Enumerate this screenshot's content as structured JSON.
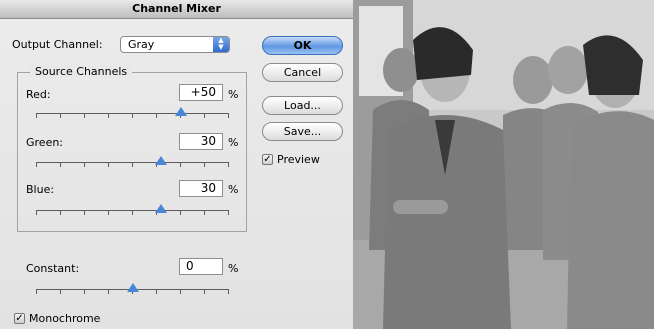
{
  "dialog": {
    "title": "Channel Mixer",
    "output_channel_label": "Output Channel:",
    "output_channel_value": "Gray",
    "source_channels_title": "Source Channels",
    "channels": [
      {
        "label": "Red:",
        "value": "+50",
        "unit": "%",
        "level": 0.75
      },
      {
        "label": "Green:",
        "value": "30",
        "unit": "%",
        "level": 0.65
      },
      {
        "label": "Blue:",
        "value": "30",
        "unit": "%",
        "level": 0.65
      }
    ],
    "constant": {
      "label": "Constant:",
      "value": "0",
      "unit": "%",
      "level": 0.5
    },
    "buttons": {
      "ok": "OK",
      "cancel": "Cancel",
      "load": "Load...",
      "save": "Save..."
    },
    "preview_label": "Preview",
    "preview_checked": true,
    "monochrome_label": "Monochrome",
    "monochrome_checked": true
  }
}
